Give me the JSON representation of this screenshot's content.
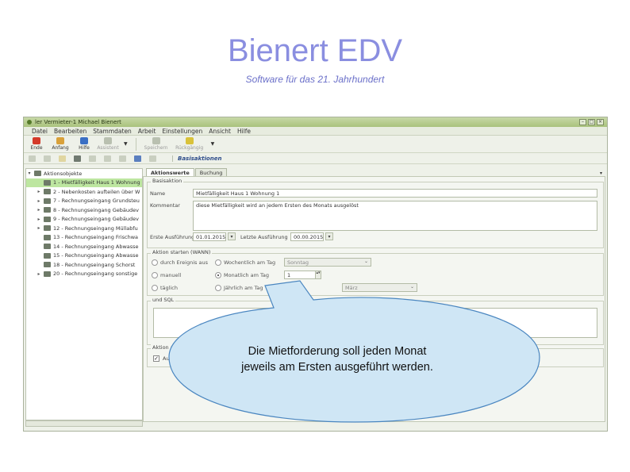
{
  "slide": {
    "title": "Bienert EDV",
    "subtitle": "Software für das 21. Jahrhundert"
  },
  "window": {
    "title": "ler Vermieter-1 Michael Bienert",
    "controls": [
      "–",
      "□",
      "×"
    ],
    "menu": [
      "Datei",
      "Bearbeiten",
      "Stammdaten",
      "Arbeit",
      "Einstellungen",
      "Ansicht",
      "Hilfe"
    ],
    "toolbar": [
      {
        "label": "Ende",
        "color": "#d43a2a",
        "enabled": true
      },
      {
        "label": "Anfang",
        "color": "#d9a13a",
        "enabled": true
      },
      {
        "label": "Hilfe",
        "color": "#3a6fc4",
        "enabled": true
      },
      {
        "label": "Assistent",
        "color": "#b9c0b0",
        "enabled": false
      },
      {
        "label": "Speichern",
        "color": "#b9c0b0",
        "enabled": false
      },
      {
        "label": "Rückgängig",
        "color": "#d9c23a",
        "enabled": false
      }
    ],
    "secondary_toolbar_label": "Basisaktionen"
  },
  "tree": {
    "items": [
      {
        "label": "Aktionsobjekte",
        "expander": "▾",
        "selected": false,
        "sub": false
      },
      {
        "label": "1 - Mietfälligkeit Haus 1 Wohnung",
        "expander": "",
        "selected": true,
        "sub": true
      },
      {
        "label": "2 - Nebenkosten aufteilen über W",
        "expander": "▸",
        "selected": false,
        "sub": true
      },
      {
        "label": "7 - Rechnungseingang Grundsteu",
        "expander": "▸",
        "selected": false,
        "sub": true
      },
      {
        "label": "8 - Rechnungseingang Gebäudev",
        "expander": "▸",
        "selected": false,
        "sub": true
      },
      {
        "label": "9 - Rechnungseingang Gebäudev",
        "expander": "▸",
        "selected": false,
        "sub": true
      },
      {
        "label": "12 - Rechnungseingang Müllabfu",
        "expander": "▸",
        "selected": false,
        "sub": true
      },
      {
        "label": "13 - Rechnungseingang Frischwa",
        "expander": "",
        "selected": false,
        "sub": true
      },
      {
        "label": "14 - Rechnungseingang Abwasse",
        "expander": "",
        "selected": false,
        "sub": true
      },
      {
        "label": "15 - Rechnungseingang Abwasse",
        "expander": "",
        "selected": false,
        "sub": true
      },
      {
        "label": "18 - Rechnungseingang Schorst",
        "expander": "",
        "selected": false,
        "sub": true
      },
      {
        "label": "20 - Rechnungseingang sonstige",
        "expander": "▸",
        "selected": false,
        "sub": true
      }
    ]
  },
  "tabs": [
    "Aktionswerte",
    "Buchung"
  ],
  "form": {
    "group_basis": "Basisaktion",
    "name_label": "Name",
    "name_value": "Mietfälligkeit Haus 1 Wohnung 1",
    "comment_label": "Kommentar",
    "comment_value": "diese Mietfälligkeit wird an jedem Ersten des Monats ausgelöst",
    "first_exec_label": "Erste Ausführung",
    "first_exec_value": "01.01.2015",
    "last_exec_label": "Letzte Ausführung",
    "last_exec_value": "00.00.2015",
    "group_when": "Aktion starten (WANN)",
    "radio_ereignis": "durch Ereignis aus",
    "radio_wochentag": "Wochentlich am Tag",
    "combo_wochentag": "Sonntag",
    "radio_manuell": "manuell",
    "radio_monatlich": "Monatlich am Tag",
    "monatlich_value": "1",
    "radio_taeglich": "täglich",
    "radio_jaehrlich": "Jährlich am Tag",
    "combo_monat": "März",
    "group_sql": "und SQL",
    "group_action": "Aktion ausführen",
    "checkbox_label": "Ausführen"
  },
  "callout": {
    "line1": "Die Mietforderung soll jeden Monat",
    "line2": "jeweils am Ersten ausgeführt werden."
  }
}
